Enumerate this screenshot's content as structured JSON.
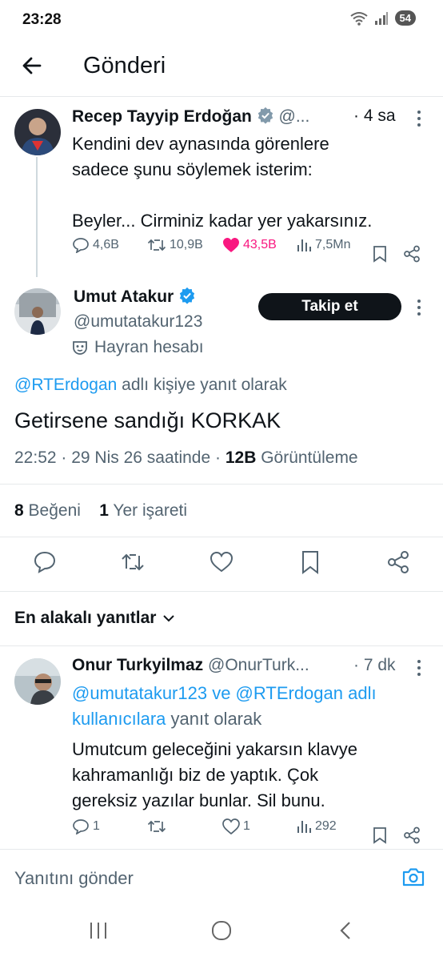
{
  "status_bar": {
    "time": "23:28",
    "battery": "54"
  },
  "header": {
    "title": "Gönderi"
  },
  "parent_post": {
    "author_name": "Recep Tayyip Erdoğan",
    "handle": "@...",
    "time": "· 4 sa",
    "text_lines": [
      "Kendini dev aynasında görenlere",
      "sadece şunu söylemek isterim:",
      "",
      "Beyler... Cirminiz kadar yer yakarsınız."
    ],
    "replies": "4,6B",
    "reposts": "10,9B",
    "likes": "43,5B",
    "views": "7,5Mn"
  },
  "main_post": {
    "author_name": "Umut Atakur",
    "handle": "@umutatakur123",
    "badge_label": "Hayran hesabı",
    "follow_label": "Takip et",
    "reply_to_handle": "@RTErdogan",
    "reply_to_suffix": "adlı kişiye yanıt olarak",
    "text": "Getirsene sandığı KORKAK",
    "time": "22:52 · 29 Nis 26 saatinde ·",
    "views_count": "12B",
    "views_label": "Görüntüleme",
    "likes_count": "8",
    "likes_label": "Beğeni",
    "bookmarks_count": "1",
    "bookmarks_label": "Yer işareti"
  },
  "replies_sort": {
    "label": "En alakalı yanıtlar"
  },
  "reply_post": {
    "author_name": "Onur Turkyilmaz",
    "handle": "@OnurTurk...",
    "time": "· 7 dk",
    "reply_to_line1": "@umutatakur123 ve @RTErdogan adlı",
    "reply_to_line2_link": "kullanıcılara",
    "reply_to_line2_suffix": "yanıt olarak",
    "text_lines": [
      "Umutcum geleceğini yakarsın klavye",
      "kahramanlığı biz de yaptık. Çok",
      "gereksiz yazılar bunlar. Sil bunu."
    ],
    "replies": "1",
    "likes": "1",
    "views": "292"
  },
  "composer": {
    "placeholder": "Yanıtını gönder"
  },
  "colors": {
    "accent": "#1d9bf0",
    "like": "#f91880",
    "text": "#0f1419",
    "muted": "#536471"
  }
}
